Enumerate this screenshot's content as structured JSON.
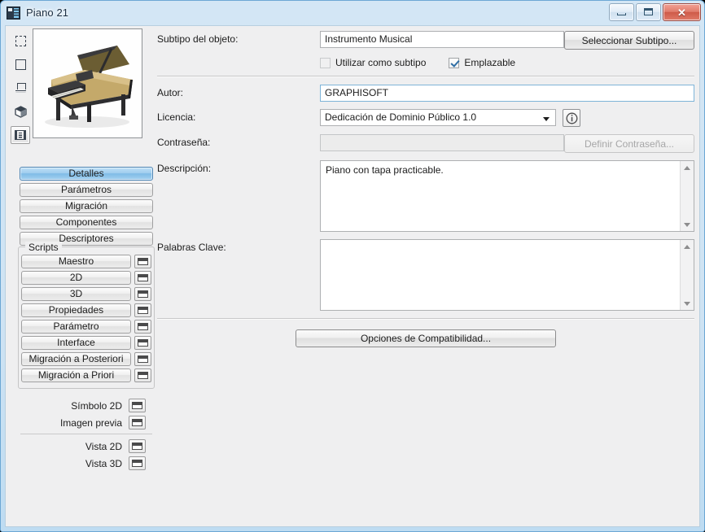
{
  "window": {
    "title": "Piano 21",
    "icon": "archicad-object-icon",
    "controls": {
      "minimize": "minimize-icon",
      "restore": "restore-icon",
      "close": "✕"
    }
  },
  "sidebar": {
    "view_icons": [
      {
        "name": "2d-symbol-dashed-icon",
        "selected": false
      },
      {
        "name": "preview-square-icon",
        "selected": false
      },
      {
        "name": "floor-plan-icon",
        "selected": false
      },
      {
        "name": "3d-cube-icon",
        "selected": false
      },
      {
        "name": "details-list-icon",
        "selected": true
      }
    ],
    "preview_alt": "grand-piano-preview",
    "nav_buttons": [
      {
        "label": "Detalles",
        "selected": true
      },
      {
        "label": "Parámetros",
        "selected": false
      },
      {
        "label": "Migración",
        "selected": false
      },
      {
        "label": "Componentes",
        "selected": false
      },
      {
        "label": "Descriptores",
        "selected": false
      }
    ],
    "scripts_group": {
      "title": "Scripts",
      "items": [
        {
          "label": "Maestro"
        },
        {
          "label": "2D"
        },
        {
          "label": "3D"
        },
        {
          "label": "Propiedades"
        },
        {
          "label": "Parámetro"
        },
        {
          "label": "Interface"
        },
        {
          "label": "Migración a Posteriori"
        },
        {
          "label": "Migración a Priori"
        }
      ]
    },
    "view_rows_top": [
      {
        "label": "Símbolo 2D"
      },
      {
        "label": "Imagen previa"
      }
    ],
    "view_rows_bottom": [
      {
        "label": "Vista 2D"
      },
      {
        "label": "Vista 3D"
      }
    ]
  },
  "main": {
    "subtype": {
      "label": "Subtipo del objeto:",
      "value": "Instrumento Musical",
      "button": "Seleccionar Subtipo..."
    },
    "checkboxes": [
      {
        "label": "Utilizar como subtipo",
        "checked": false,
        "disabled": true
      },
      {
        "label": "Emplazable",
        "checked": true,
        "disabled": false
      }
    ],
    "author": {
      "label": "Autor:",
      "value": "GRAPHISOFT"
    },
    "license": {
      "label": "Licencia:",
      "value": "Dedicación de Dominio Público 1.0",
      "info_icon": "info-circle-icon"
    },
    "password": {
      "label": "Contraseña:",
      "value": "",
      "button": "Definir Contraseña..."
    },
    "description": {
      "label": "Descripción:",
      "value": "Piano con tapa practicable."
    },
    "keywords": {
      "label": "Palabras Clave:",
      "value": ""
    },
    "compatibility_button": "Opciones de Compatibilidad..."
  }
}
